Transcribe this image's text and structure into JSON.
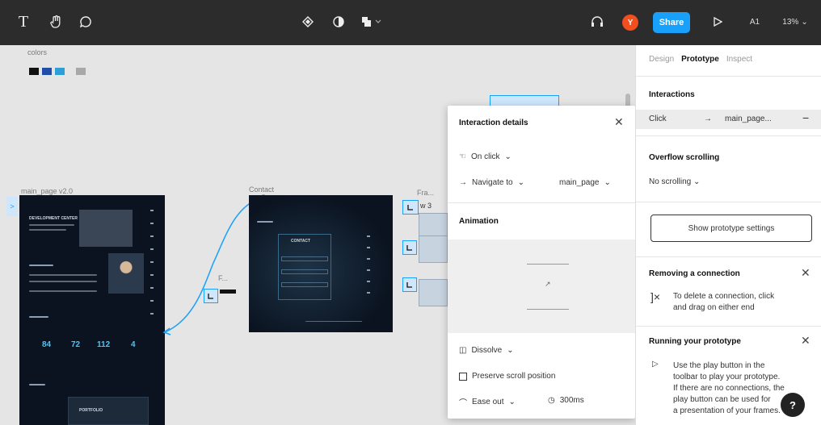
{
  "toolbar": {
    "text_tool": "T",
    "hand_tool": "✋",
    "comment_tool": "💬",
    "share_label": "Share",
    "avatar_initial": "Y",
    "zoom_label": "13%",
    "ai_label": "A1",
    "icons": [
      "text-icon",
      "hand-icon",
      "comment-icon",
      "component-icon",
      "contrast-icon",
      "layers-icon",
      "headphones-icon",
      "play-icon"
    ]
  },
  "canvas": {
    "colors_label": "colors",
    "swatches": [
      "#111111",
      "#1f4ea8",
      "#2d9fd6",
      "#a8a8a8"
    ],
    "frames": {
      "main_page": "main_page v2.0",
      "contact": "Contact",
      "small_frame": "Fra..."
    },
    "main_page_content": {
      "headline": "DEVELOPMENT CENTER",
      "stats": [
        "84",
        "72",
        "112",
        "4"
      ],
      "footer_label": "PORTFOLIO"
    },
    "contact_content": {
      "form_title": "CONTACT"
    },
    "handle_labels": [
      "F...",
      "w 3"
    ]
  },
  "popover": {
    "title": "Interaction details",
    "trigger": "On click",
    "action": "Navigate to",
    "destination": "main_page",
    "animation_title": "Animation",
    "transition": "Dissolve",
    "preserve_scroll": "Preserve scroll position",
    "easing": "Ease out",
    "duration": "300ms"
  },
  "panel": {
    "tabs": [
      "Design",
      "Prototype",
      "Inspect"
    ],
    "active_tab": "Prototype",
    "interactions_title": "Interactions",
    "interaction_trigger": "Click",
    "interaction_target": "main_page...",
    "overflow_title": "Overflow scrolling",
    "overflow_value": "No scrolling",
    "show_settings_button": "Show prototype settings",
    "removing_title": "Removing a connection",
    "removing_text_1": "To delete a connection, click",
    "removing_text_2": "and drag on either end",
    "running_title": "Running your prototype",
    "running_text": [
      "Use the play button in the",
      "toolbar to play your prototype.",
      "If there are no connections, the",
      "play button can be used for",
      "a presentation of your frames."
    ],
    "help_label": "?"
  },
  "colors": {
    "toolbar_bg": "#2c2c2c",
    "accent": "#18a0fb",
    "avatar": "#f24e1e",
    "frame_bg": "#0c1320"
  }
}
